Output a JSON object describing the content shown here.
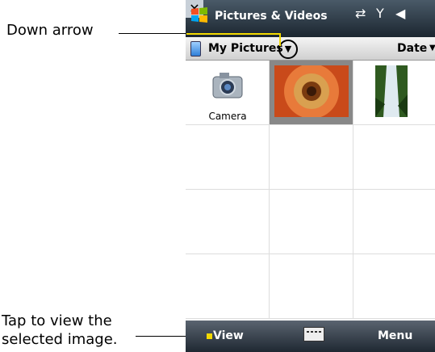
{
  "callouts": {
    "down_arrow": "Down arrow",
    "tap_line1": "Tap to view the",
    "tap_line2": "selected image."
  },
  "titlebar": {
    "title": "Pictures & Videos",
    "close_label": "✕",
    "status_icons": [
      "sync-icon",
      "signal-icon",
      "volume-icon"
    ]
  },
  "folderbar": {
    "folder": "My Pictures",
    "sort": "Date"
  },
  "grid": {
    "camera_label": "Camera"
  },
  "softbar": {
    "left": "View",
    "right": "Menu"
  },
  "colors": {
    "accent": "#f3d900",
    "selection": "#888888"
  }
}
